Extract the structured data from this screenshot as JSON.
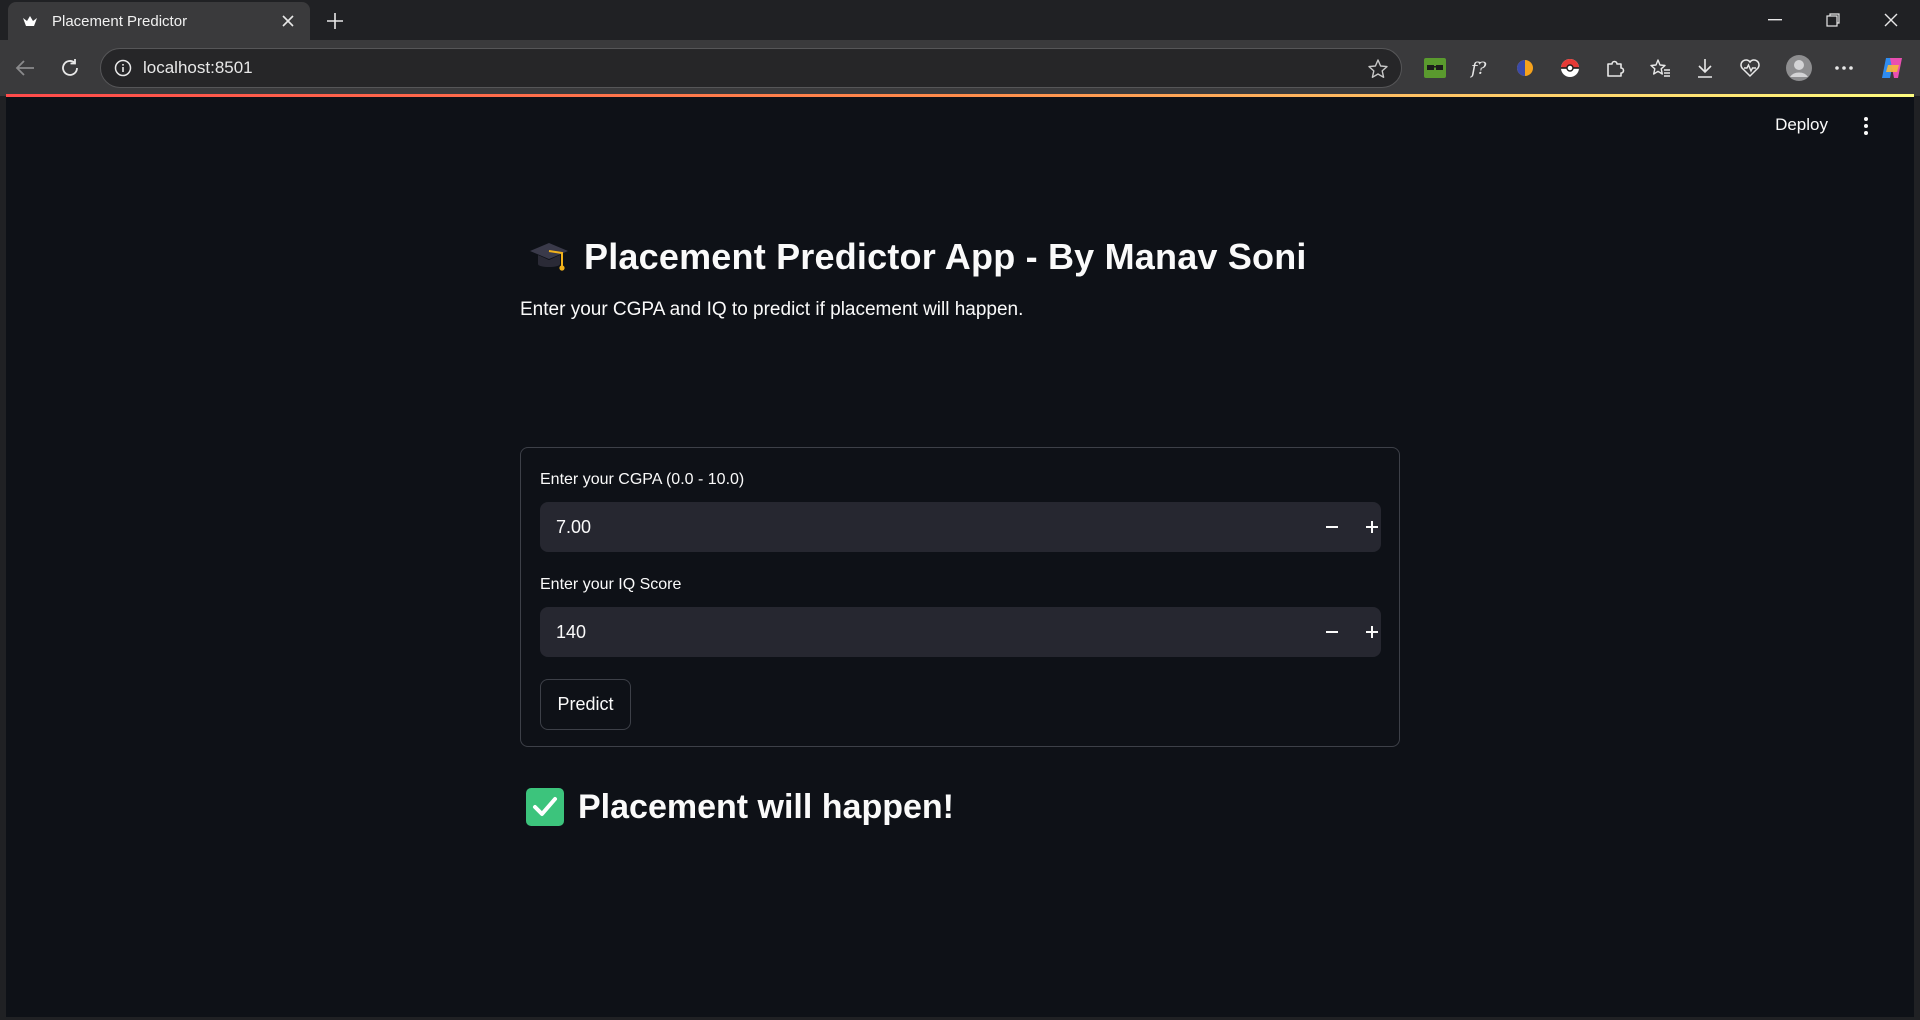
{
  "browser": {
    "tab_title": "Placement Predictor",
    "url": "localhost:8501"
  },
  "app": {
    "deploy_label": "Deploy",
    "title_emoji": "graduation-cap-emoji",
    "title": "Placement Predictor App - By Manav Soni",
    "description": "Enter your CGPA and IQ to predict if placement will happen.",
    "form": {
      "cgpa_label": "Enter your CGPA (0.0 - 10.0)",
      "cgpa_value": "7.00",
      "iq_label": "Enter your IQ Score",
      "iq_value": "140",
      "predict_label": "Predict"
    },
    "result_emoji": "check-mark-emoji",
    "result_text": "Placement will happen!"
  },
  "colors": {
    "app_background": "#0e1117",
    "input_background": "#262730",
    "success_check": "#3cc47c",
    "accent_bar": "#ff4b4b"
  }
}
